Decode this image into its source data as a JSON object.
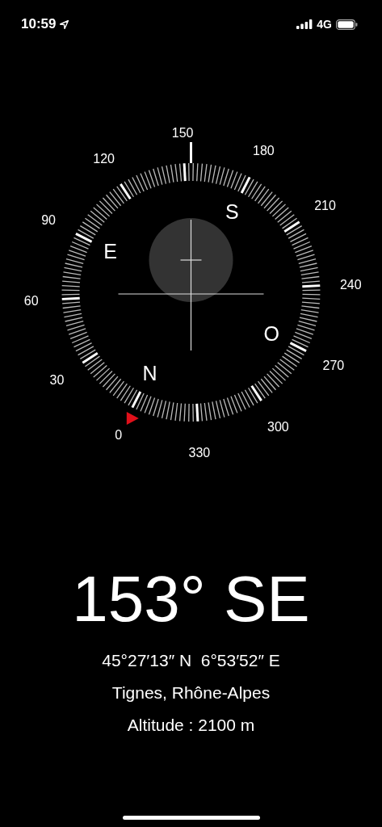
{
  "status_bar": {
    "time": "10:59",
    "network": "4G"
  },
  "compass": {
    "degree_labels": [
      "0",
      "30",
      "60",
      "90",
      "120",
      "150",
      "180",
      "210",
      "240",
      "270",
      "300",
      "330"
    ],
    "cardinal_labels": [
      "N",
      "E",
      "S",
      "O"
    ]
  },
  "heading": "153° SE",
  "coordinates": "45°27′13″ N  6°53′52″ E",
  "place": "Tignes, Rhône-Alpes",
  "altitude": "Altitude : 2100 m"
}
